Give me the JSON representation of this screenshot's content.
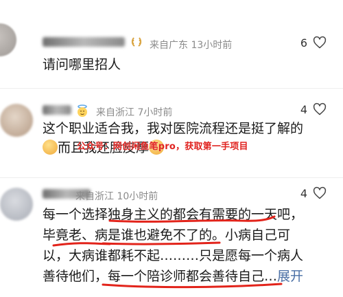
{
  "comments": [
    {
      "meta": "来自广东 13小时前",
      "likes": "6",
      "text": "请问哪里招人"
    },
    {
      "meta": "来自浙江 7小时前",
      "likes": "4",
      "text_line1": "这个职业适合我，我对医院流程还是挺了解的",
      "text_line2": "而且我还脸皮厚",
      "watermark": "公众号：网创闲鱼笔pro，获取第一手项目"
    },
    {
      "meta": "来自浙江 10小时前",
      "likes": "4",
      "line1": "每一个选择独身主义的都会有需要的一天吧，",
      "line2": "毕竟老、病是谁也避免不了的。小病自己可",
      "line3": "以，大病谁都耗不起………只是愿每一个病人",
      "line4": "善待他们，每一个陪诊师都会善待自己…",
      "expand_label": "展开"
    }
  ],
  "colors": {
    "underline": "#e2231a",
    "watermark": "#e0221f",
    "meta": "#8a8a8a"
  },
  "icons": [
    "laurel-badge-icon",
    "halo-emoji-icon",
    "heart-icon",
    "doge-emoji-icon",
    "grin-emoji-icon"
  ]
}
